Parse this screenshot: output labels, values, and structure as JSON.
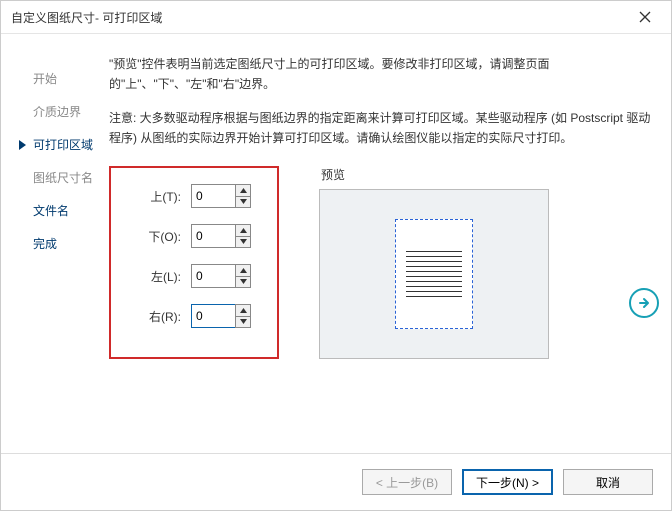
{
  "window_title": "自定义图纸尺寸- 可打印区域",
  "sidebar": {
    "items": [
      {
        "label": "开始"
      },
      {
        "label": "介质边界"
      },
      {
        "label": "可打印区域"
      },
      {
        "label": "图纸尺寸名"
      },
      {
        "label": "文件名"
      },
      {
        "label": "完成"
      }
    ]
  },
  "main": {
    "desc": "\"预览\"控件表明当前选定图纸尺寸上的可打印区域。要修改非打印区域，请调整页面的\"上\"、\"下\"、\"左\"和\"右\"边界。",
    "note": "注意: 大多数驱动程序根据与图纸边界的指定距离来计算可打印区域。某些驱动程序 (如 Postscript 驱动程序) 从图纸的实际边界开始计算可打印区域。请确认绘图仪能以指定的实际尺寸打印。",
    "margins": {
      "top_label": "上(T):",
      "top_value": "0",
      "bottom_label": "下(O):",
      "bottom_value": "0",
      "left_label": "左(L):",
      "left_value": "0",
      "right_label": "右(R):",
      "right_value": "0"
    },
    "preview_label": "预览"
  },
  "footer": {
    "back": "< 上一步(B)",
    "next": "下一步(N) >",
    "cancel": "取消"
  }
}
